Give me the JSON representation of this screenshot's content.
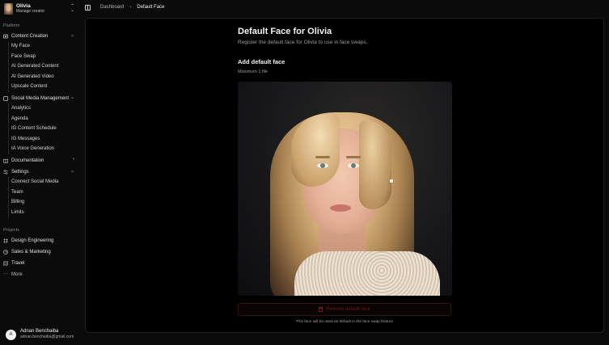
{
  "creator": {
    "name": "Olivia",
    "subtitle": "Manage creator"
  },
  "sidebar": {
    "platform_label": "Platform",
    "content_creation": {
      "label": "Content Creation",
      "items": [
        "My Face",
        "Face Swap",
        "AI Generated Content",
        "AI Generated Video",
        "Upscale Content"
      ]
    },
    "social_media": {
      "label": "Social Media Management",
      "items": [
        "Analytics",
        "Agenda",
        "IG Content Schedule",
        "IG Messages",
        "IA Voice Generation"
      ]
    },
    "documentation": {
      "label": "Documentation"
    },
    "settings": {
      "label": "Settings",
      "items": [
        "Connect Social Media",
        "Team",
        "Billing",
        "Limits"
      ]
    },
    "projects_label": "Projects",
    "projects": [
      "Design Engineering",
      "Sales & Marketing",
      "Travel"
    ],
    "more_label": "More"
  },
  "user": {
    "initial": "A",
    "name": "Adnan Benchaiba",
    "email": "adnan.benchaiba@gmail.com"
  },
  "breadcrumb": {
    "parent": "Dashboard",
    "current": "Default Face"
  },
  "main": {
    "title": "Default Face for Olivia",
    "subtitle": "Register the default face for Olivia to use in face swaps.",
    "section_title": "Add default face",
    "max_files": "Maximum 1 file",
    "remove_label": "Remove default face",
    "note": "This face will be used as default in the face swap feature"
  },
  "colors": {
    "background": "#0b0b0c",
    "panel": "#000000",
    "danger": "#6b1c1c"
  },
  "icons": [
    "chevrons-up-down-icon",
    "sidebar-toggle-icon",
    "chevron-right-icon",
    "chevron-down-icon",
    "book-icon",
    "settings-icon",
    "frame-icon",
    "pie-chart-icon",
    "map-icon",
    "more-horizontal-icon",
    "trash-icon"
  ]
}
